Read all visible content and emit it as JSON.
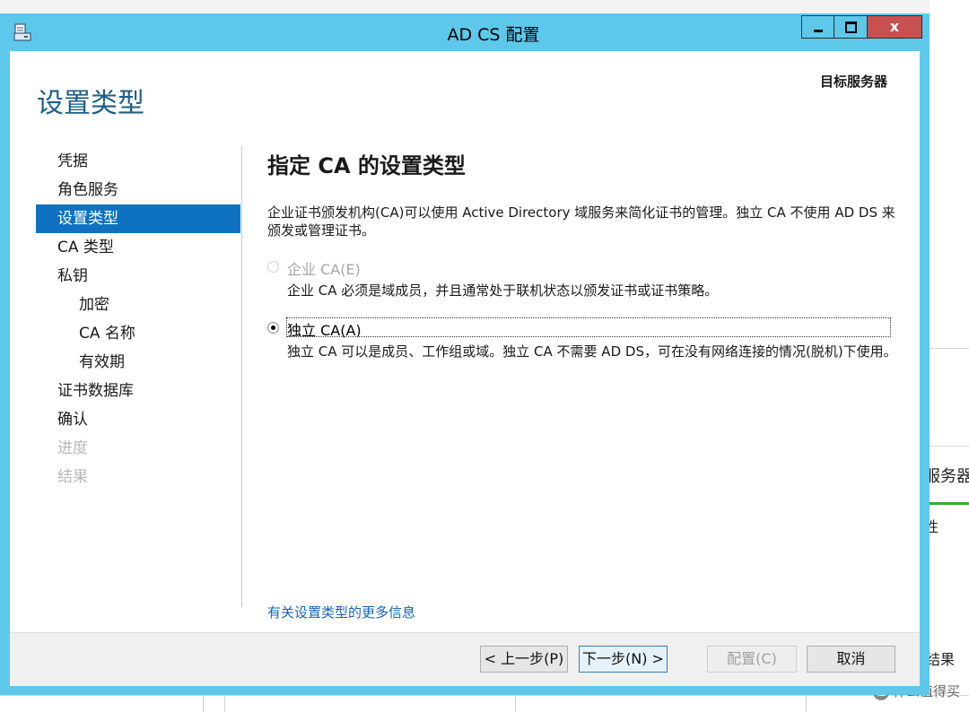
{
  "window": {
    "title": "AD CS 配置",
    "close_glyph": "x"
  },
  "header": {
    "page_title": "设置类型",
    "target_server_label": "目标服务器"
  },
  "nav": {
    "items": [
      {
        "label": "凭据",
        "state": "normal"
      },
      {
        "label": "角色服务",
        "state": "normal"
      },
      {
        "label": "设置类型",
        "state": "active"
      },
      {
        "label": "CA 类型",
        "state": "normal"
      },
      {
        "label": "私钥",
        "state": "normal"
      },
      {
        "label": "加密",
        "state": "sub"
      },
      {
        "label": "CA 名称",
        "state": "sub"
      },
      {
        "label": "有效期",
        "state": "sub"
      },
      {
        "label": "证书数据库",
        "state": "normal"
      },
      {
        "label": "确认",
        "state": "normal"
      },
      {
        "label": "进度",
        "state": "disabled"
      },
      {
        "label": "结果",
        "state": "disabled"
      }
    ]
  },
  "main": {
    "heading": "指定 CA 的设置类型",
    "description": "企业证书颁发机构(CA)可以使用 Active Directory 域服务来简化证书的管理。独立 CA 不使用 AD DS 来颁发或管理证书。",
    "options": [
      {
        "label": "企业 CA(E)",
        "description": "企业 CA 必须是域成员，并且通常处于联机状态以颁发证书或证书策略。",
        "checked": false,
        "enabled": false
      },
      {
        "label": "独立 CA(A)",
        "description": "独立 CA 可以是成员、工作组或域。独立 CA 不需要 AD DS，可在没有网络连接的情况(脱机)下使用。",
        "checked": true,
        "enabled": true
      }
    ],
    "more_info_link": "有关设置类型的更多信息"
  },
  "footer": {
    "prev_label": "< 上一步(P)",
    "next_label": "下一步(N) >",
    "configure_label": "配置(C)",
    "cancel_label": "取消"
  },
  "background": {
    "fragment_1": "服务器",
    "fragment_2": "性",
    "fragment_3": "结果",
    "watermark": "什么值得买"
  },
  "colors": {
    "titlebar": "#5ec8ea",
    "close_button": "#c75050",
    "nav_active": "#0f72c0",
    "page_title": "#1d5e86",
    "link": "#1764b8"
  }
}
